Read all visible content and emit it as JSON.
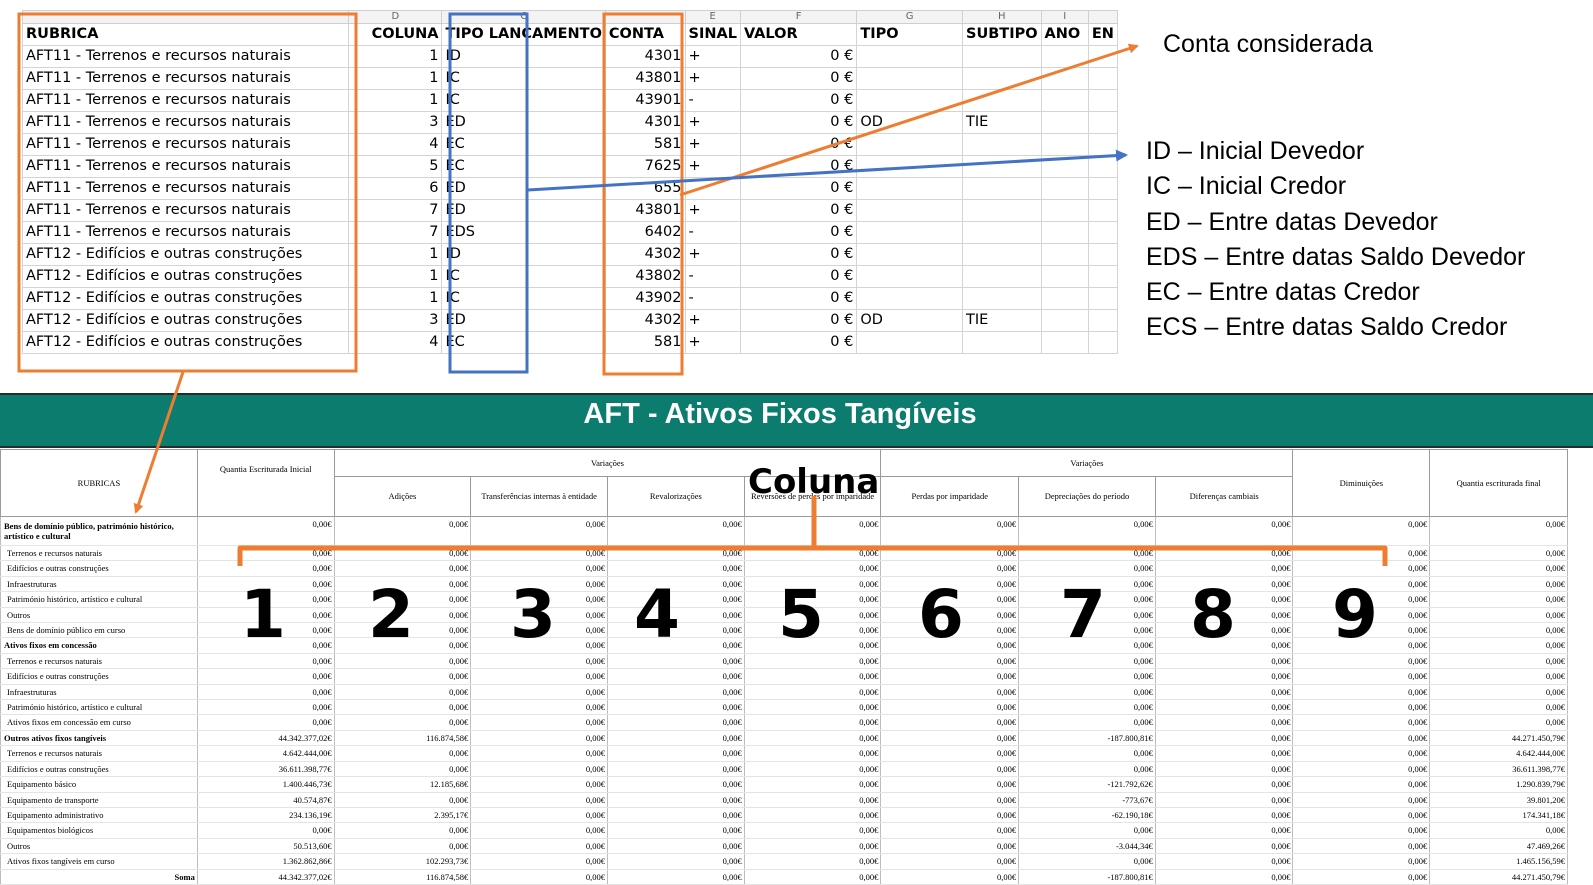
{
  "sheet": {
    "col_letters": [
      "",
      "D",
      "C",
      "",
      "E",
      "F",
      "G",
      "H",
      "I",
      ""
    ],
    "headers": [
      "RUBRICA",
      "COLUNA",
      "TIPO LANÇAMENTO",
      "CONTA",
      "SINAL",
      "VALOR",
      "TIPO",
      "SUBTIPO",
      "ANO",
      "ENT"
    ],
    "header_tipo": "TIPO LANCAMENTO",
    "header_ent": "EN",
    "rows": [
      {
        "rubrica": "AFT11 - Terrenos e recursos naturais",
        "coluna": "1",
        "tipo_lanc": "ID",
        "conta": "4301",
        "sinal": "+",
        "valor": "0 €",
        "tipo": "",
        "subtipo": ""
      },
      {
        "rubrica": "AFT11 - Terrenos e recursos naturais",
        "coluna": "1",
        "tipo_lanc": "IC",
        "conta": "43801",
        "sinal": "+",
        "valor": "0 €",
        "tipo": "",
        "subtipo": ""
      },
      {
        "rubrica": "AFT11 - Terrenos e recursos naturais",
        "coluna": "1",
        "tipo_lanc": "IC",
        "conta": "43901",
        "sinal": "-",
        "valor": "0 €",
        "tipo": "",
        "subtipo": ""
      },
      {
        "rubrica": "AFT11 - Terrenos e recursos naturais",
        "coluna": "3",
        "tipo_lanc": "ED",
        "conta": "4301",
        "sinal": "+",
        "valor": "0 €",
        "tipo": "OD",
        "subtipo": "TIE"
      },
      {
        "rubrica": "AFT11 - Terrenos e recursos naturais",
        "coluna": "4",
        "tipo_lanc": "EC",
        "conta": "581",
        "sinal": "+",
        "valor": "0 €",
        "tipo": "",
        "subtipo": ""
      },
      {
        "rubrica": "AFT11 - Terrenos e recursos naturais",
        "coluna": "5",
        "tipo_lanc": "EC",
        "conta": "7625",
        "sinal": "+",
        "valor": "0 €",
        "tipo": "",
        "subtipo": ""
      },
      {
        "rubrica": "AFT11 - Terrenos e recursos naturais",
        "coluna": "6",
        "tipo_lanc": "ED",
        "conta": "655",
        "sinal": "",
        "valor": "0 €",
        "tipo": "",
        "subtipo": ""
      },
      {
        "rubrica": "AFT11 - Terrenos e recursos naturais",
        "coluna": "7",
        "tipo_lanc": "ED",
        "conta": "43801",
        "sinal": "+",
        "valor": "0 €",
        "tipo": "",
        "subtipo": ""
      },
      {
        "rubrica": "AFT11 - Terrenos e recursos naturais",
        "coluna": "7",
        "tipo_lanc": "EDS",
        "conta": "6402",
        "sinal": "-",
        "valor": "0 €",
        "tipo": "",
        "subtipo": ""
      },
      {
        "rubrica": "AFT12 - Edifícios e outras construções",
        "coluna": "1",
        "tipo_lanc": "ID",
        "conta": "4302",
        "sinal": "+",
        "valor": "0 €",
        "tipo": "",
        "subtipo": ""
      },
      {
        "rubrica": "AFT12 - Edifícios e outras construções",
        "coluna": "1",
        "tipo_lanc": "IC",
        "conta": "43802",
        "sinal": "-",
        "valor": "0 €",
        "tipo": "",
        "subtipo": ""
      },
      {
        "rubrica": "AFT12 - Edifícios e outras construções",
        "coluna": "1",
        "tipo_lanc": "IC",
        "conta": "43902",
        "sinal": "-",
        "valor": "0 €",
        "tipo": "",
        "subtipo": ""
      },
      {
        "rubrica": "AFT12 - Edifícios e outras construções",
        "coluna": "3",
        "tipo_lanc": "ED",
        "conta": "4302",
        "sinal": "+",
        "valor": "0 €",
        "tipo": "OD",
        "subtipo": "TIE"
      },
      {
        "rubrica": "AFT12 - Edifícios e outras construções",
        "coluna": "4",
        "tipo_lanc": "EC",
        "conta": "581",
        "sinal": "+",
        "valor": "0 €",
        "tipo": "",
        "subtipo": ""
      }
    ]
  },
  "annotations": {
    "conta_considerada": "Conta considerada",
    "legend": [
      "ID – Inicial Devedor",
      "IC – Inicial Credor",
      "ED – Entre datas Devedor",
      "EDS – Entre datas Saldo Devedor",
      "EC – Entre datas Credor",
      "ECS – Entre datas Saldo Credor"
    ],
    "coluna_label": "Coluna",
    "column_numbers": [
      "1",
      "2",
      "3",
      "4",
      "5",
      "6",
      "7",
      "8",
      "9"
    ],
    "colors": {
      "orange": "#ee7d31",
      "blue": "#4472c4"
    }
  },
  "report": {
    "title": "AFT - Ativos Fixos Tangíveis",
    "banner_color": "#0c7c6e",
    "headers": {
      "rubricas": "RUBRICAS",
      "inicial": "Quantia Escriturada Inicial",
      "variacoes_left": "Variações",
      "variacoes_right": "Variações",
      "adicoes": "Adições",
      "transferencias": "Transferências internas à entidade",
      "revalorizacoes": "Revalorizações",
      "reversoes": "Reversões de perdas por imparidade",
      "perdas": "Perdas por imparidade",
      "depreciacoes": "Depreciações do período",
      "diferencas": "Diferenças cambiais",
      "diminuicoes": "Diminuições",
      "final": "Quantia escriturada final"
    },
    "rows": [
      {
        "label": "Bens de domínio público, património histórico, artístico e cultural",
        "bold": true,
        "vals": [
          "0,00€",
          "0,00€",
          "0,00€",
          "0,00€",
          "0,00€",
          "0,00€",
          "0,00€",
          "0,00€",
          "0,00€",
          "0,00€"
        ]
      },
      {
        "label": "Terrenos e recursos naturais",
        "bold": false,
        "vals": [
          "0,00€",
          "0,00€",
          "0,00€",
          "0,00€",
          "0,00€",
          "0,00€",
          "0,00€",
          "0,00€",
          "0,00€",
          "0,00€"
        ]
      },
      {
        "label": "Edifícios e outras construções",
        "bold": false,
        "vals": [
          "0,00€",
          "0,00€",
          "0,00€",
          "0,00€",
          "0,00€",
          "0,00€",
          "0,00€",
          "0,00€",
          "0,00€",
          "0,00€"
        ]
      },
      {
        "label": "Infraestruturas",
        "bold": false,
        "vals": [
          "0,00€",
          "0,00€",
          "0,00€",
          "0,00€",
          "0,00€",
          "0,00€",
          "0,00€",
          "0,00€",
          "0,00€",
          "0,00€"
        ]
      },
      {
        "label": "Património histórico, artístico e cultural",
        "bold": false,
        "vals": [
          "0,00€",
          "0,00€",
          "0,00€",
          "0,00€",
          "0,00€",
          "0,00€",
          "0,00€",
          "0,00€",
          "0,00€",
          "0,00€"
        ]
      },
      {
        "label": "Outros",
        "bold": false,
        "vals": [
          "0,00€",
          "0,00€",
          "0,00€",
          "0,00€",
          "0,00€",
          "0,00€",
          "0,00€",
          "0,00€",
          "0,00€",
          "0,00€"
        ]
      },
      {
        "label": "Bens de domínio público em curso",
        "bold": false,
        "vals": [
          "0,00€",
          "0,00€",
          "0,00€",
          "0,00€",
          "0,00€",
          "0,00€",
          "0,00€",
          "0,00€",
          "0,00€",
          "0,00€"
        ]
      },
      {
        "label": "Ativos fixos em concessão",
        "bold": true,
        "vals": [
          "0,00€",
          "0,00€",
          "0,00€",
          "0,00€",
          "0,00€",
          "0,00€",
          "0,00€",
          "0,00€",
          "0,00€",
          "0,00€"
        ]
      },
      {
        "label": "Terrenos e recursos naturais",
        "bold": false,
        "vals": [
          "0,00€",
          "0,00€",
          "0,00€",
          "0,00€",
          "0,00€",
          "0,00€",
          "0,00€",
          "0,00€",
          "0,00€",
          "0,00€"
        ]
      },
      {
        "label": "Edifícios e outras construções",
        "bold": false,
        "vals": [
          "0,00€",
          "0,00€",
          "0,00€",
          "0,00€",
          "0,00€",
          "0,00€",
          "0,00€",
          "0,00€",
          "0,00€",
          "0,00€"
        ]
      },
      {
        "label": "Infraestruturas",
        "bold": false,
        "vals": [
          "0,00€",
          "0,00€",
          "0,00€",
          "0,00€",
          "0,00€",
          "0,00€",
          "0,00€",
          "0,00€",
          "0,00€",
          "0,00€"
        ]
      },
      {
        "label": "Património histórico, artístico e cultural",
        "bold": false,
        "vals": [
          "0,00€",
          "0,00€",
          "0,00€",
          "0,00€",
          "0,00€",
          "0,00€",
          "0,00€",
          "0,00€",
          "0,00€",
          "0,00€"
        ]
      },
      {
        "label": "Ativos fixos em concessão em curso",
        "bold": false,
        "vals": [
          "0,00€",
          "0,00€",
          "0,00€",
          "0,00€",
          "0,00€",
          "0,00€",
          "0,00€",
          "0,00€",
          "0,00€",
          "0,00€"
        ]
      },
      {
        "label": "Outros ativos fixos tangíveis",
        "bold": true,
        "vals": [
          "44.342.377,02€",
          "116.874,58€",
          "0,00€",
          "0,00€",
          "0,00€",
          "0,00€",
          "-187.800,81€",
          "0,00€",
          "0,00€",
          "44.271.450,79€"
        ]
      },
      {
        "label": "Terrenos e recursos naturais",
        "bold": false,
        "vals": [
          "4.642.444,00€",
          "0,00€",
          "0,00€",
          "0,00€",
          "0,00€",
          "0,00€",
          "0,00€",
          "0,00€",
          "0,00€",
          "4.642.444,00€"
        ]
      },
      {
        "label": "Edifícios e outras construções",
        "bold": false,
        "vals": [
          "36.611.398,77€",
          "0,00€",
          "0,00€",
          "0,00€",
          "0,00€",
          "0,00€",
          "0,00€",
          "0,00€",
          "0,00€",
          "36.611.398,77€"
        ]
      },
      {
        "label": "Equipamento básico",
        "bold": false,
        "vals": [
          "1.400.446,73€",
          "12.185,68€",
          "0,00€",
          "0,00€",
          "0,00€",
          "0,00€",
          "-121.792,62€",
          "0,00€",
          "0,00€",
          "1.290.839,79€"
        ]
      },
      {
        "label": "Equipamento de transporte",
        "bold": false,
        "vals": [
          "40.574,87€",
          "0,00€",
          "0,00€",
          "0,00€",
          "0,00€",
          "0,00€",
          "-773,67€",
          "0,00€",
          "0,00€",
          "39.801,20€"
        ]
      },
      {
        "label": "Equipamento administrativo",
        "bold": false,
        "vals": [
          "234.136,19€",
          "2.395,17€",
          "0,00€",
          "0,00€",
          "0,00€",
          "0,00€",
          "-62.190,18€",
          "0,00€",
          "0,00€",
          "174.341,18€"
        ]
      },
      {
        "label": "Equipamentos biológicos",
        "bold": false,
        "vals": [
          "0,00€",
          "0,00€",
          "0,00€",
          "0,00€",
          "0,00€",
          "0,00€",
          "0,00€",
          "0,00€",
          "0,00€",
          "0,00€"
        ]
      },
      {
        "label": "Outros",
        "bold": false,
        "vals": [
          "50.513,60€",
          "0,00€",
          "0,00€",
          "0,00€",
          "0,00€",
          "0,00€",
          "-3.044,34€",
          "0,00€",
          "0,00€",
          "47.469,26€"
        ]
      },
      {
        "label": "Ativos fixos tangíveis em curso",
        "bold": false,
        "vals": [
          "1.362.862,86€",
          "102.293,73€",
          "0,00€",
          "0,00€",
          "0,00€",
          "0,00€",
          "0,00€",
          "0,00€",
          "0,00€",
          "1.465.156,59€"
        ]
      },
      {
        "label": "Soma",
        "bold": false,
        "soma": true,
        "vals": [
          "44.342.377,02€",
          "116.874,58€",
          "0,00€",
          "0,00€",
          "0,00€",
          "0,00€",
          "-187.800,81€",
          "0,00€",
          "0,00€",
          "44.271.450,79€"
        ]
      }
    ]
  }
}
